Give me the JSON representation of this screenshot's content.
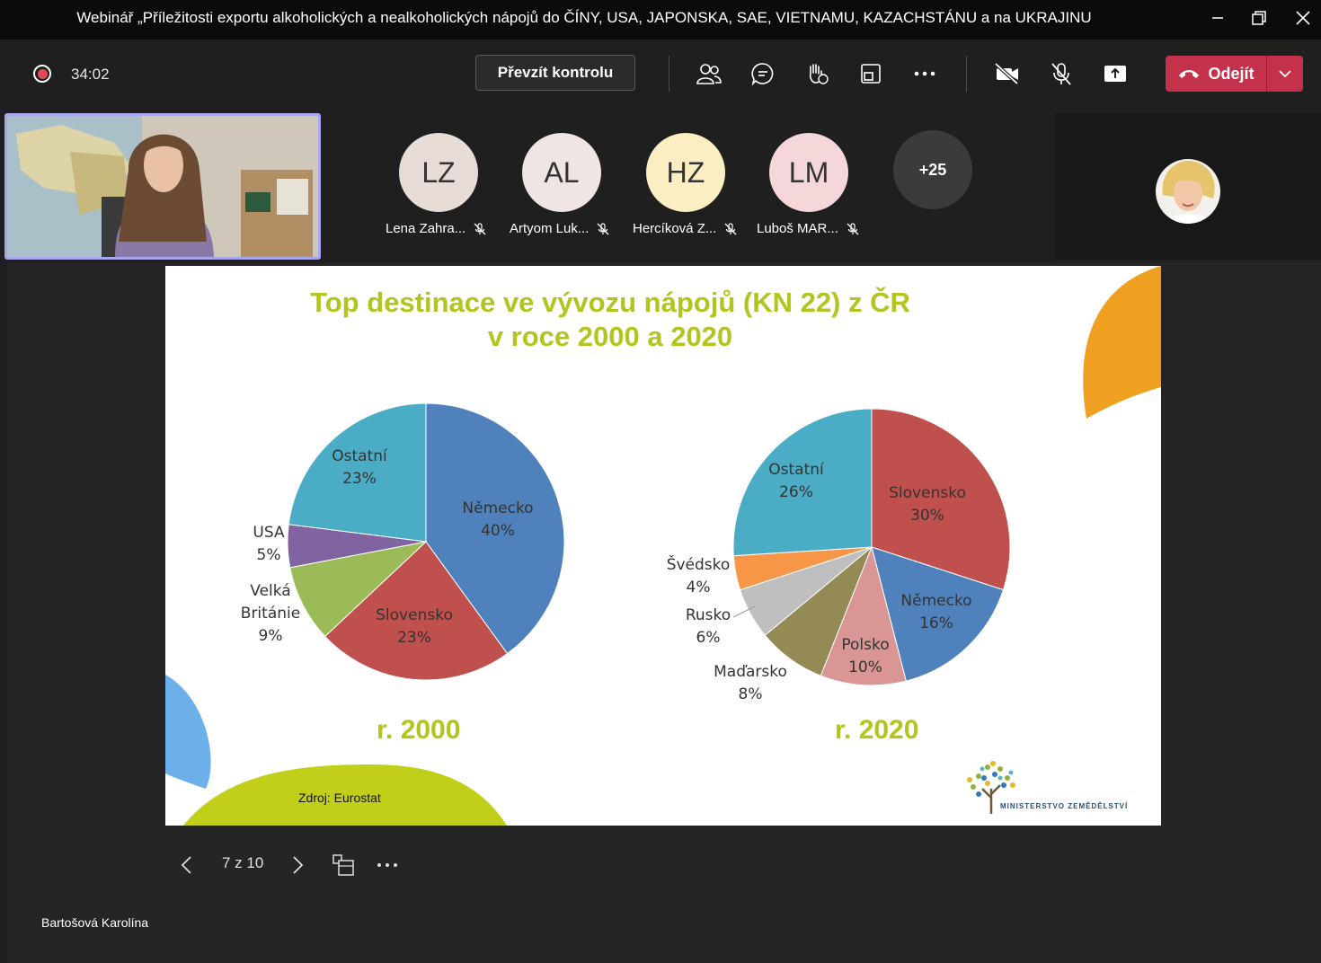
{
  "window": {
    "title": "Webinář „Příležitosti exportu alkoholických a nealkoholických nápojů do ČÍNY, USA, JAPONSKA, SAE, VIETNAMU, KAZACHSTÁNU a na UKRAJINU"
  },
  "toolbar": {
    "timer": "34:02",
    "take_control_label": "Převzít kontrolu",
    "leave_label": "Odejít",
    "icons": [
      "people-icon",
      "chat-icon",
      "raise-hand-icon",
      "view-icon",
      "more-icon",
      "camera-off-icon",
      "mic-off-icon",
      "share-icon"
    ]
  },
  "participants": [
    {
      "initials": "LZ",
      "name": "Lena Zahra...",
      "color": "#e8dcd7"
    },
    {
      "initials": "AL",
      "name": "Artyom Luk...",
      "color": "#efe5e2"
    },
    {
      "initials": "HZ",
      "name": "Hercíková Z...",
      "color": "#fbeec3"
    },
    {
      "initials": "LM",
      "name": "Luboš MAR...",
      "color": "#f5d7d9"
    }
  ],
  "overflow_count": "+25",
  "slide": {
    "title_line1": "Top destinace ve vývozu nápojů (KN 22) z ČR",
    "title_line2": "v roce 2000 a 2020",
    "source": "Zdroj: Eurostat",
    "ministry": "MINISTERSTVO ZEMĚDĚLSTVÍ",
    "accent_color": "#b3c41e"
  },
  "chart_data": [
    {
      "type": "pie",
      "title": "r. 2000",
      "slices": [
        {
          "label": "Německo",
          "value": 40,
          "pct": "40%",
          "color": "#4f81bd"
        },
        {
          "label": "Slovensko",
          "value": 23,
          "pct": "23%",
          "color": "#c0504d"
        },
        {
          "label": "Velká Británie",
          "value": 9,
          "pct": "9%",
          "color": "#9bbb59"
        },
        {
          "label": "USA",
          "value": 5,
          "pct": "5%",
          "color": "#8064a2"
        },
        {
          "label": "Ostatní",
          "value": 23,
          "pct": "23%",
          "color": "#4bacc6"
        }
      ]
    },
    {
      "type": "pie",
      "title": "r. 2020",
      "slices": [
        {
          "label": "Slovensko",
          "value": 30,
          "pct": "30%",
          "color": "#c0504d"
        },
        {
          "label": "Německo",
          "value": 16,
          "pct": "16%",
          "color": "#4f81bd"
        },
        {
          "label": "Polsko",
          "value": 10,
          "pct": "10%",
          "color": "#d99694"
        },
        {
          "label": "Maďarsko",
          "value": 8,
          "pct": "8%",
          "color": "#948a54"
        },
        {
          "label": "Rusko",
          "value": 6,
          "pct": "6%",
          "color": "#bfbfbf"
        },
        {
          "label": "Švédsko",
          "value": 4,
          "pct": "4%",
          "color": "#f79646"
        },
        {
          "label": "Ostatní",
          "value": 26,
          "pct": "26%",
          "color": "#4bacc6"
        }
      ]
    }
  ],
  "slide_nav": {
    "page_indicator": "7 z 10"
  },
  "presenter_name": "Bartošová Karolína"
}
